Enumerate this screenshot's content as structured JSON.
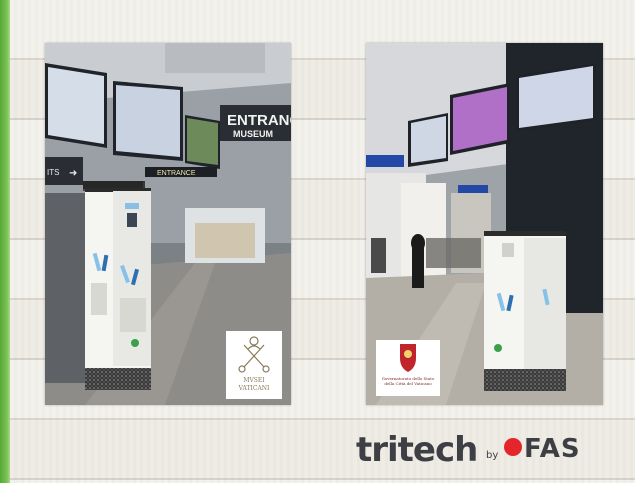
{
  "image": {
    "left_photo": {
      "signs": {
        "entrance_big": "ENTRANCE",
        "museum": "MUSEUM",
        "entrance_small": "ENTRANCE",
        "exits": "ITS"
      },
      "logo": {
        "line1": "MVSEI",
        "line2": "VATICANI"
      }
    },
    "right_photo": {
      "logo": {
        "line1": "Governatorato dello Stato della Città del Vaticano"
      }
    },
    "brand": {
      "name": "tritech",
      "by": "by",
      "partner": "FAS"
    },
    "colors": {
      "green_edge": "#7cc252",
      "efas_red": "#e4262c",
      "kiosk_pattern": "#2b2b2b"
    }
  }
}
